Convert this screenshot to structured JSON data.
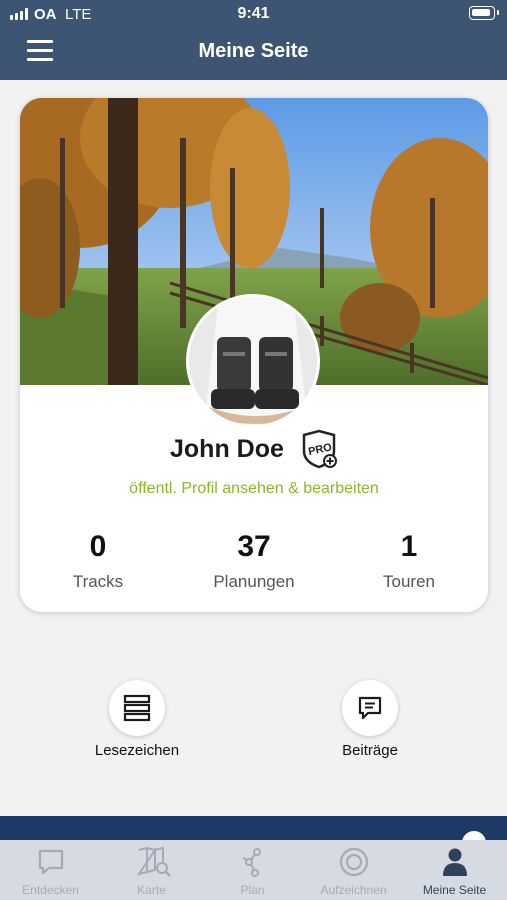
{
  "status_bar": {
    "carrier": "OA",
    "network": "LTE",
    "time": "9:41"
  },
  "header": {
    "title": "Meine Seite"
  },
  "profile": {
    "name": "John Doe",
    "badge_icon": "pro-plus-badge-icon",
    "profile_link": "öffentl. Profil ansehen & bearbeiten",
    "stats": [
      {
        "value": "0",
        "label": "Tracks"
      },
      {
        "value": "37",
        "label": "Planungen"
      },
      {
        "value": "1",
        "label": "Touren"
      }
    ]
  },
  "shortcuts": [
    {
      "label": "Lesezeichen",
      "icon": "bookmark-list-icon"
    },
    {
      "label": "Beiträge",
      "icon": "speech-bubble-icon"
    }
  ],
  "tabs": [
    {
      "label": "Entdecken",
      "icon": "chat-bubble-icon"
    },
    {
      "label": "Karte",
      "icon": "map-search-icon"
    },
    {
      "label": "Plan",
      "icon": "route-icon"
    },
    {
      "label": "Aufzeichnen",
      "icon": "record-icon"
    },
    {
      "label": "Meine Seite",
      "icon": "person-icon"
    }
  ],
  "colors": {
    "header": "#3d5573",
    "accent_green": "#8ab82a",
    "tab_active": "#2d3f58",
    "tab_inactive": "#a3aab5",
    "strip": "#1d3a66"
  }
}
